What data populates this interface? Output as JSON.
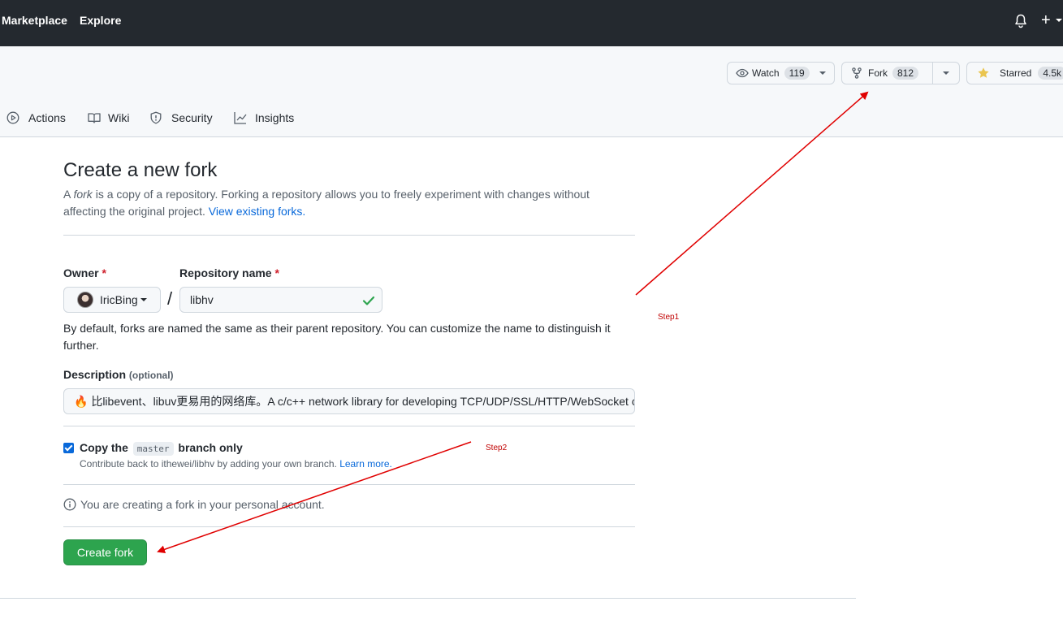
{
  "header": {
    "nav": [
      "Marketplace",
      "Explore"
    ],
    "icons": [
      "bell-icon",
      "plus-icon"
    ]
  },
  "repo_actions": {
    "watch": {
      "label": "Watch",
      "count": "119"
    },
    "fork": {
      "label": "Fork",
      "count": "812"
    },
    "star": {
      "label": "Starred",
      "count": "4.5k"
    }
  },
  "tabs": [
    {
      "label": "Actions",
      "icon": "play-icon"
    },
    {
      "label": "Wiki",
      "icon": "book-icon"
    },
    {
      "label": "Security",
      "icon": "shield-icon"
    },
    {
      "label": "Insights",
      "icon": "graph-icon"
    }
  ],
  "form": {
    "title": "Create a new fork",
    "lead_prefix": "A ",
    "lead_em": "fork",
    "lead_text": " is a copy of a repository. Forking a repository allows you to freely experiment with changes without affecting the original project. ",
    "lead_link": "View existing forks.",
    "owner_label": "Owner",
    "required_mark": "*",
    "owner_value": "IricBing",
    "separator": "/",
    "repo_label": "Repository name",
    "repo_value": "libhv",
    "repo_note": "By default, forks are named the same as their parent repository. You can customize the name to distinguish it further.",
    "desc_label": "Description",
    "desc_optional": "(optional)",
    "desc_value": "🔥 比libevent、libuv更易用的网络库。A c/c++ network library for developing TCP/UDP/SSL/HTTP/WebSocket client/server.",
    "copy_branch_prefix": "Copy the",
    "copy_branch_code": "master",
    "copy_branch_suffix": "branch only",
    "copy_branch_checked": true,
    "copy_branch_note": "Contribute back to ithewei/libhv by adding your own branch. ",
    "copy_branch_link": "Learn more.",
    "info_text": "You are creating a fork in your personal account.",
    "create_button": "Create fork"
  },
  "annotations": {
    "step1": "Step1",
    "step2": "Step2",
    "color": "#e00000"
  }
}
